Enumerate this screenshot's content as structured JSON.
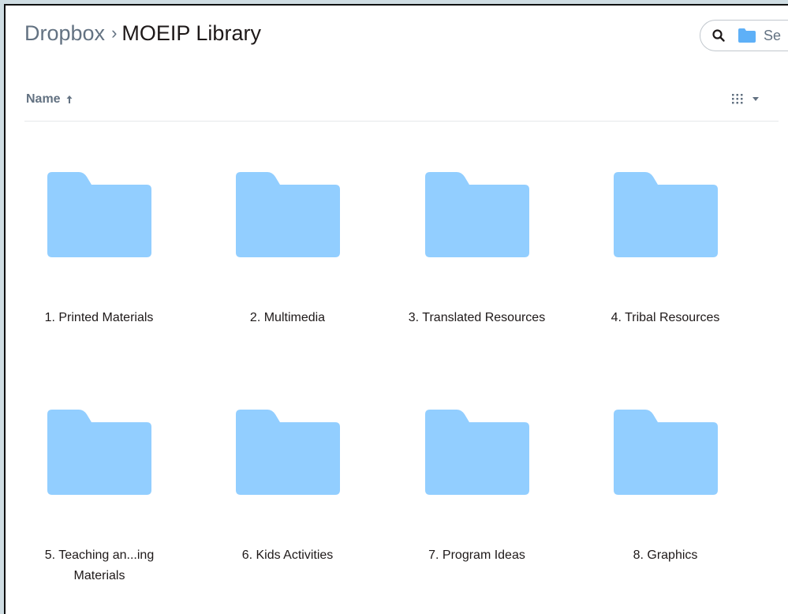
{
  "breadcrumb": {
    "root": "Dropbox",
    "separator": "›",
    "current": "MOEIP Library"
  },
  "search": {
    "text": "Se",
    "icon": "search-icon",
    "scope_icon": "folder-icon"
  },
  "sort": {
    "label": "Name",
    "direction_icon": "arrow-up-icon"
  },
  "view": {
    "icon": "grid-icon",
    "caret_icon": "caret-down-icon"
  },
  "colors": {
    "folder": "#92ceff",
    "folder_tab": "#85c3f7",
    "text": "#1e1919",
    "muted": "#637282",
    "page_background": "#cfdde3"
  },
  "folders": [
    {
      "label": "1. Printed Materials"
    },
    {
      "label": "2. Multimedia"
    },
    {
      "label": "3. Translated Resources"
    },
    {
      "label": "4. Tribal Resources"
    },
    {
      "label": "5. Teaching an...ing Materials"
    },
    {
      "label": "6. Kids Activities"
    },
    {
      "label": "7. Program Ideas"
    },
    {
      "label": "8. Graphics"
    }
  ]
}
